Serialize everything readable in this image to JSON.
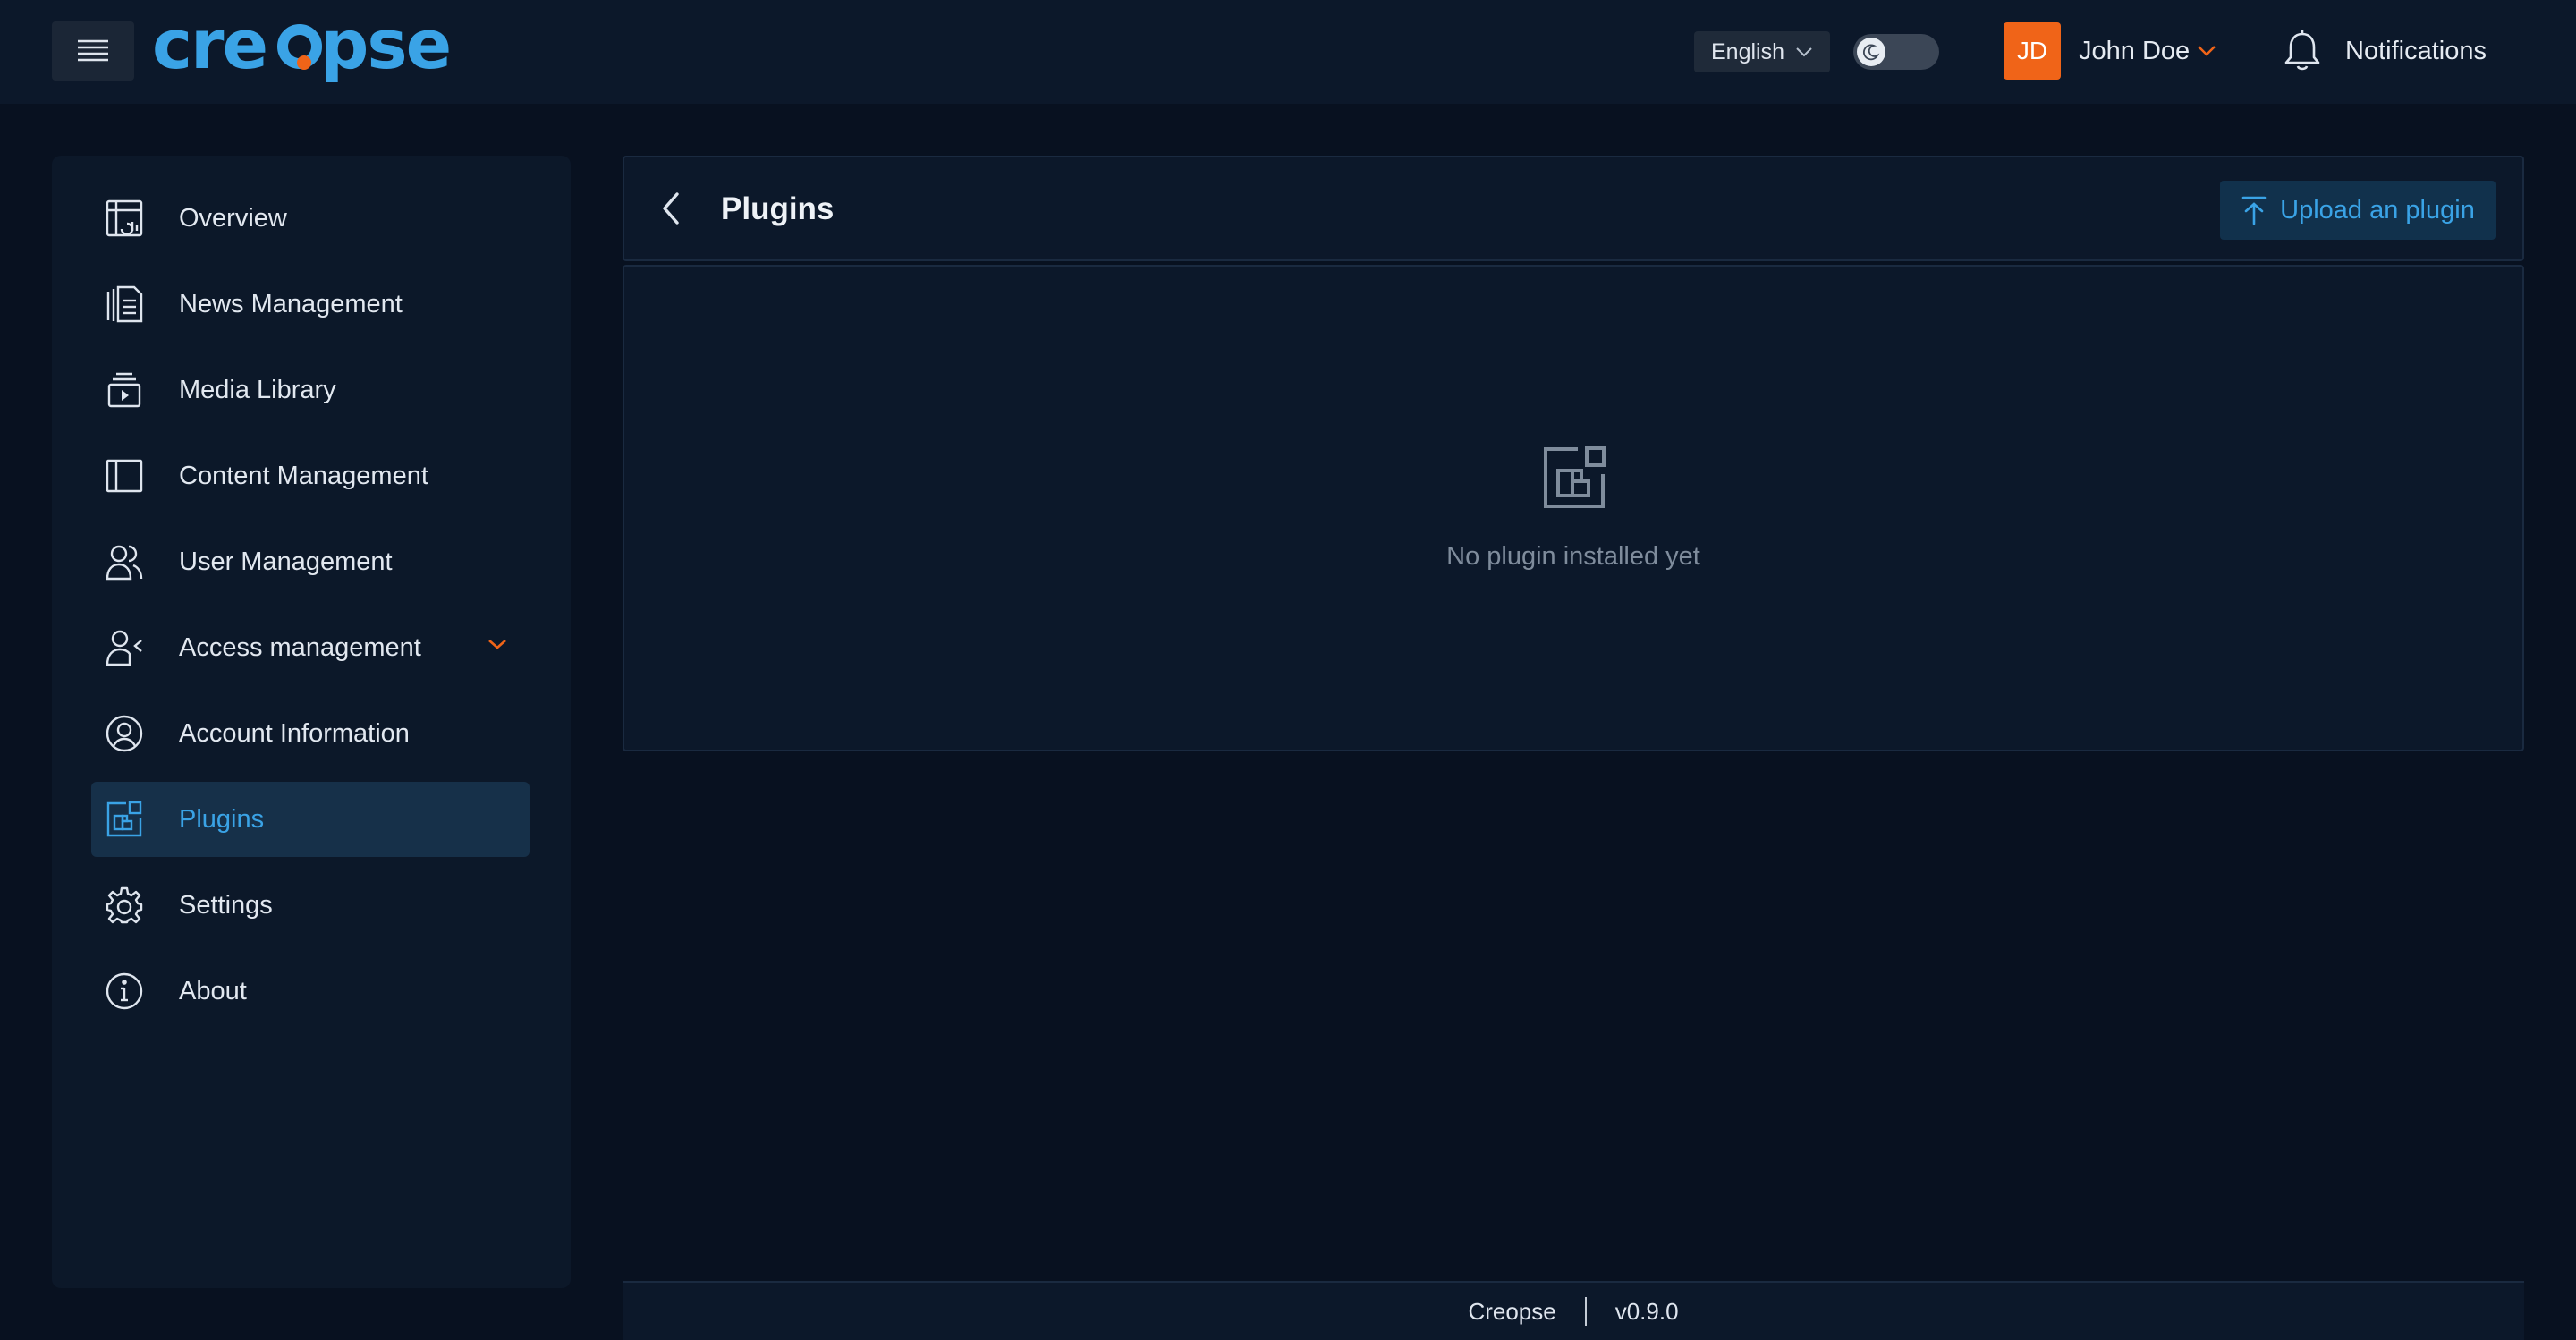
{
  "header": {
    "logo_text": "creopse",
    "language": "English",
    "user_initials": "JD",
    "user_name": "John Doe",
    "notifications_label": "Notifications"
  },
  "sidebar": {
    "items": [
      {
        "label": "Overview",
        "icon": "overview-icon"
      },
      {
        "label": "News Management",
        "icon": "news-icon"
      },
      {
        "label": "Media Library",
        "icon": "media-icon"
      },
      {
        "label": "Content Management",
        "icon": "content-icon"
      },
      {
        "label": "User Management",
        "icon": "users-icon"
      },
      {
        "label": "Access management",
        "icon": "access-icon"
      },
      {
        "label": "Account Information",
        "icon": "account-icon"
      },
      {
        "label": "Plugins",
        "icon": "plugins-icon"
      },
      {
        "label": "Settings",
        "icon": "gear-icon"
      },
      {
        "label": "About",
        "icon": "info-icon"
      }
    ],
    "active": "Plugins"
  },
  "page": {
    "title": "Plugins",
    "upload_label": "Upload an plugin",
    "empty_text": "No plugin installed yet"
  },
  "footer": {
    "app_name": "Creopse",
    "version": "v0.9.0"
  },
  "colors": {
    "background": "#081120",
    "panel": "#0c182a",
    "accent": "#3aa3e6",
    "brand_orange": "#f06418"
  }
}
